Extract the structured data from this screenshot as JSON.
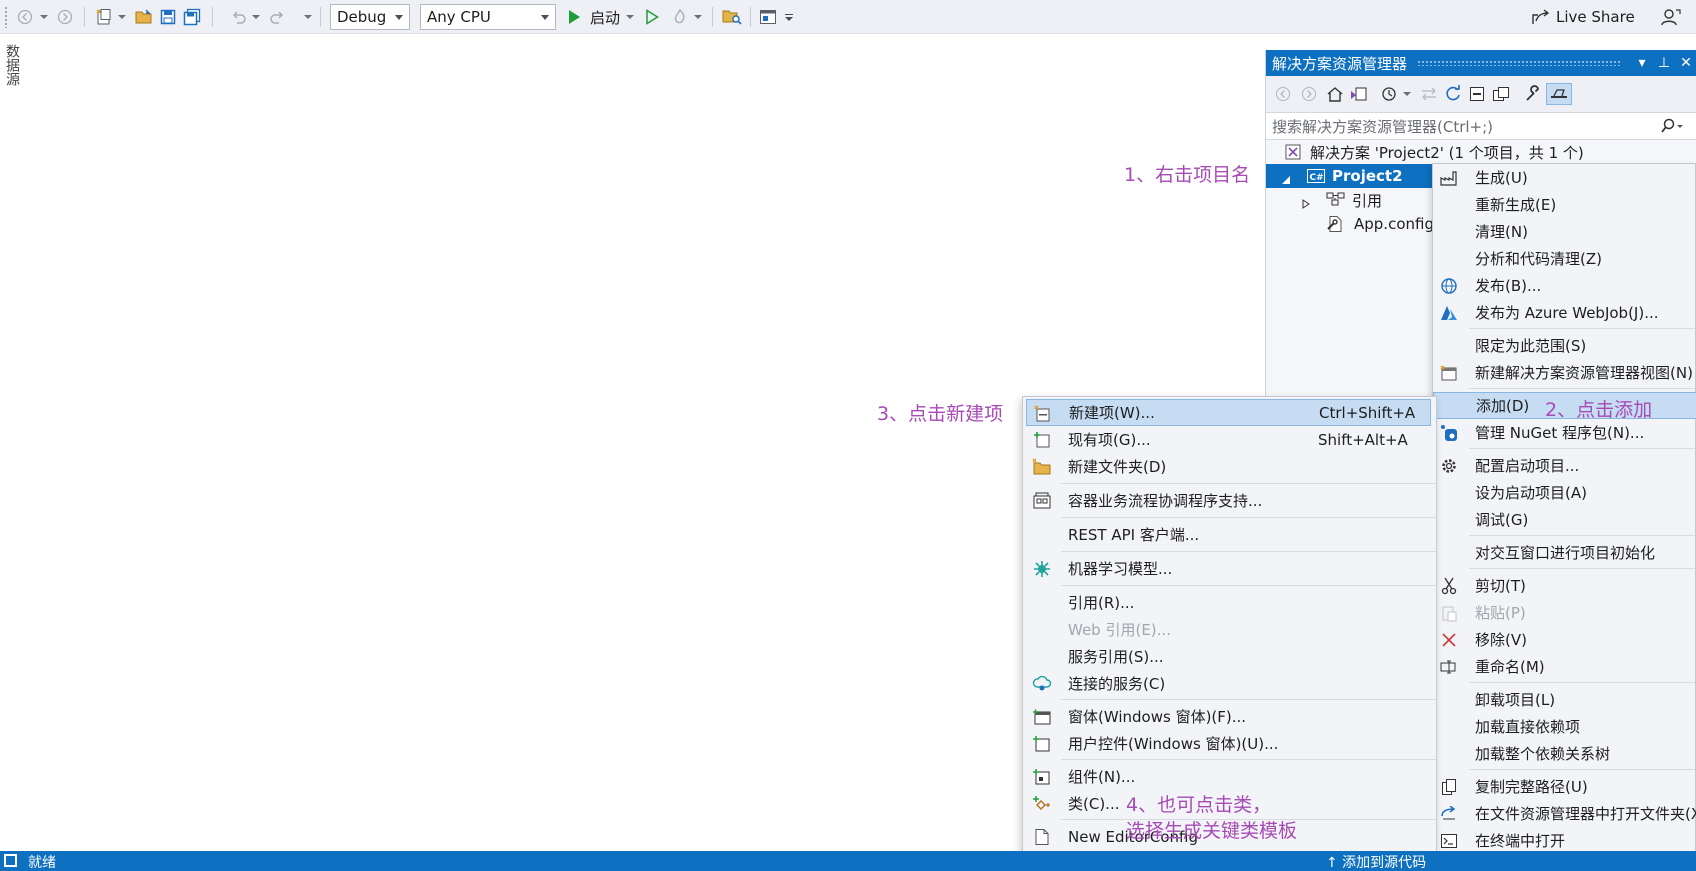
{
  "toolbar": {
    "config": "Debug",
    "platform": "Any CPU",
    "start_label": "启动",
    "live_share": "Live Share"
  },
  "left_tab": {
    "label": "数据源"
  },
  "solution_explorer": {
    "title": "解决方案资源管理器",
    "search_placeholder": "搜索解决方案资源管理器(Ctrl+;)",
    "tree": {
      "solution": "解决方案 'Project2' (1 个项目，共 1 个)",
      "project": "Project2",
      "references": "引用",
      "app_config": "App.config"
    }
  },
  "context_menu": {
    "items": [
      {
        "label": "生成(U)"
      },
      {
        "label": "重新生成(E)"
      },
      {
        "label": "清理(N)"
      },
      {
        "label": "分析和代码清理(Z)"
      },
      {
        "label": "发布(B)..."
      },
      {
        "label": "发布为 Azure WebJob(J)..."
      },
      {
        "label": "限定为此范围(S)"
      },
      {
        "label": "新建解决方案资源管理器视图(N)"
      },
      {
        "label": "添加(D)"
      },
      {
        "label": "管理 NuGet 程序包(N)..."
      },
      {
        "label": "配置启动项目..."
      },
      {
        "label": "设为启动项目(A)"
      },
      {
        "label": "调试(G)"
      },
      {
        "label": "对交互窗口进行项目初始化"
      },
      {
        "label": "剪切(T)"
      },
      {
        "label": "粘贴(P)"
      },
      {
        "label": "移除(V)"
      },
      {
        "label": "重命名(M)"
      },
      {
        "label": "卸载项目(L)"
      },
      {
        "label": "加载直接依赖项"
      },
      {
        "label": "加载整个依赖关系树"
      },
      {
        "label": "复制完整路径(U)"
      },
      {
        "label": "在文件资源管理器中打开文件夹(X)"
      },
      {
        "label": "在终端中打开"
      }
    ]
  },
  "add_submenu": {
    "items": [
      {
        "label": "新建项(W)...",
        "shortcut": "Ctrl+Shift+A"
      },
      {
        "label": "现有项(G)...",
        "shortcut": "Shift+Alt+A"
      },
      {
        "label": "新建文件夹(D)"
      },
      {
        "label": "容器业务流程协调程序支持..."
      },
      {
        "label": "REST API 客户端..."
      },
      {
        "label": "机器学习模型..."
      },
      {
        "label": "引用(R)..."
      },
      {
        "label": "Web 引用(E)..."
      },
      {
        "label": "服务引用(S)..."
      },
      {
        "label": "连接的服务(C)"
      },
      {
        "label": "窗体(Windows 窗体)(F)..."
      },
      {
        "label": "用户控件(Windows 窗体)(U)..."
      },
      {
        "label": "组件(N)..."
      },
      {
        "label": "类(C)..."
      },
      {
        "label": "New EditorConfig"
      }
    ]
  },
  "annotations": {
    "step1": "1、右击项目名",
    "step2": "2、点击添加",
    "step3": "3、点击新建项",
    "step4_line1": "4、也可点击类，",
    "step4_line2": "选择生成关键类模板"
  },
  "status_bar": {
    "left": "就绪",
    "right": "↑  添加到源代码"
  },
  "colors": {
    "accent": "#0e70c0",
    "annotation": "#a64bb4",
    "menu_highlight": "#c6dcf3"
  }
}
